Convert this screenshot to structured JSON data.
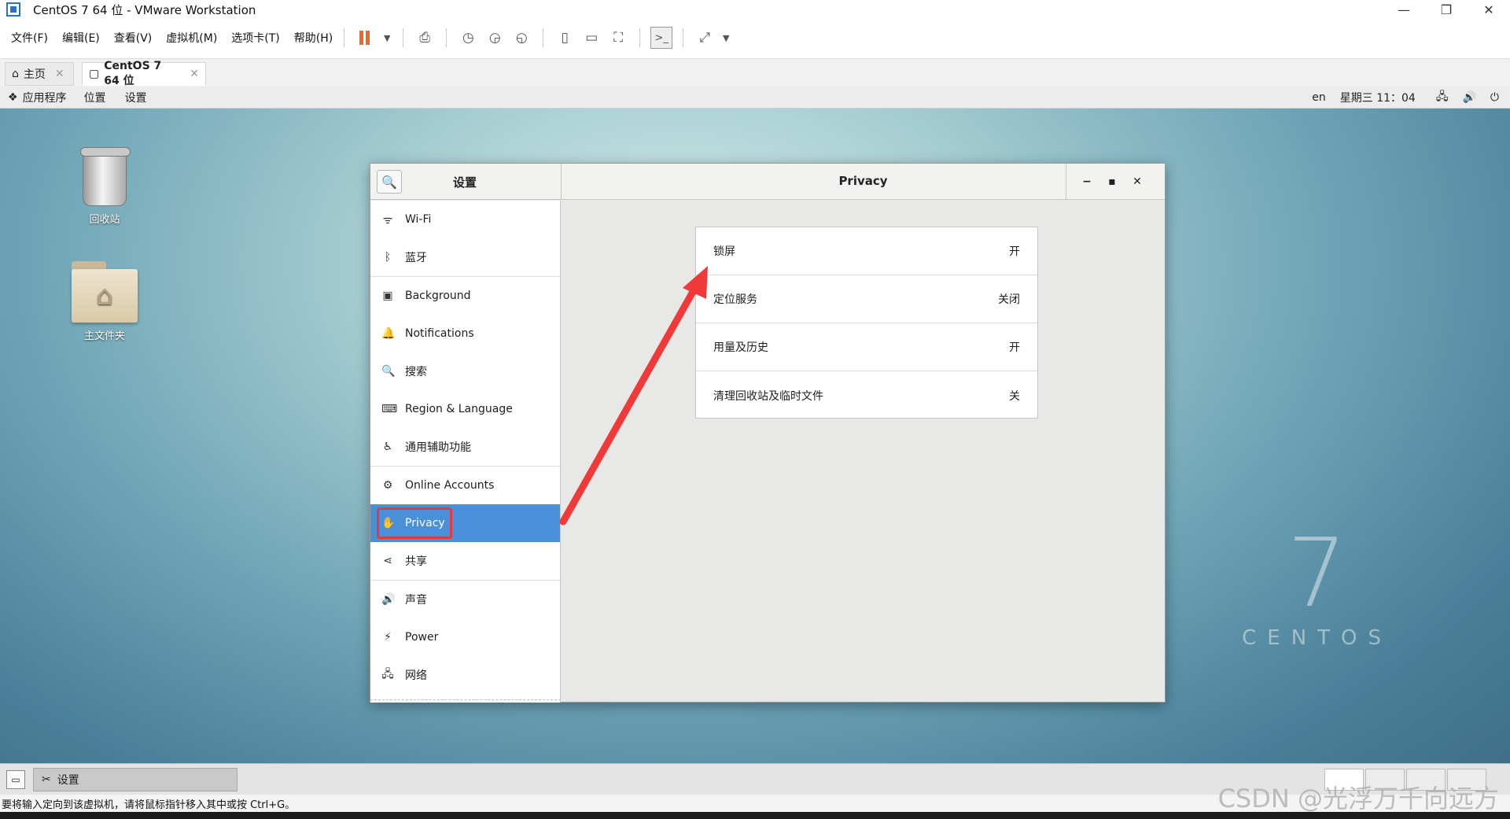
{
  "window": {
    "title": "CentOS 7 64 位 - VMware Workstation",
    "minimize": "—",
    "restore": "❐",
    "close": "✕"
  },
  "menubar": {
    "items": [
      "文件(F)",
      "编辑(E)",
      "查看(V)",
      "虚拟机(M)",
      "选项卡(T)",
      "帮助(H)"
    ]
  },
  "tabs": [
    {
      "label": "主页",
      "icon": "home-icon"
    },
    {
      "label": "CentOS 7 64 位",
      "icon": "vm-icon"
    }
  ],
  "gnome_topbar": {
    "apps": "应用程序",
    "places": "位置",
    "current_app": "设置",
    "lang": "en",
    "clock": "星期三 11：04"
  },
  "desktop": {
    "trash_label": "回收站",
    "home_label": "主文件夹",
    "logo_number": "7",
    "logo_text": "CENTOS"
  },
  "settings": {
    "left_title": "设置",
    "page_title": "Privacy",
    "sidebar": [
      {
        "label": "Wi-Fi",
        "icon": "wifi-icon",
        "glyph": "ᯤ"
      },
      {
        "label": "蓝牙",
        "icon": "bluetooth-icon",
        "glyph": "ᛒ"
      },
      {
        "label": "Background",
        "icon": "background-icon",
        "glyph": "▣"
      },
      {
        "label": "Notifications",
        "icon": "bell-icon",
        "glyph": "🔔"
      },
      {
        "label": "搜索",
        "icon": "search-icon",
        "glyph": "🔍"
      },
      {
        "label": "Region & Language",
        "icon": "region-icon",
        "glyph": "⌨"
      },
      {
        "label": "通用辅助功能",
        "icon": "accessibility-icon",
        "glyph": "♿"
      },
      {
        "label": "Online Accounts",
        "icon": "accounts-icon",
        "glyph": "⚙"
      },
      {
        "label": "Privacy",
        "icon": "hand-icon",
        "glyph": "✋"
      },
      {
        "label": "共享",
        "icon": "share-icon",
        "glyph": "⋖"
      },
      {
        "label": "声音",
        "icon": "speaker-icon",
        "glyph": "🔊"
      },
      {
        "label": "Power",
        "icon": "power-icon",
        "glyph": "⚡"
      },
      {
        "label": "网络",
        "icon": "network-icon",
        "glyph": "🖧"
      }
    ],
    "privacy_rows": [
      {
        "label": "锁屏",
        "value": "开"
      },
      {
        "label": "定位服务",
        "value": "关闭"
      },
      {
        "label": "用量及历史",
        "value": "开"
      },
      {
        "label": "清理回收站及临时文件",
        "value": "关"
      }
    ]
  },
  "guest_taskbar": {
    "task_label": "设置"
  },
  "statusbar": {
    "text": "要将输入定向到该虚拟机，请将鼠标指针移入其中或按 Ctrl+G。"
  },
  "watermark": "CSDN @光浮万千向远方",
  "colors": {
    "selection": "#4a90d9",
    "highlight_box": "#e5373f",
    "arrow": "#f03a3a"
  }
}
